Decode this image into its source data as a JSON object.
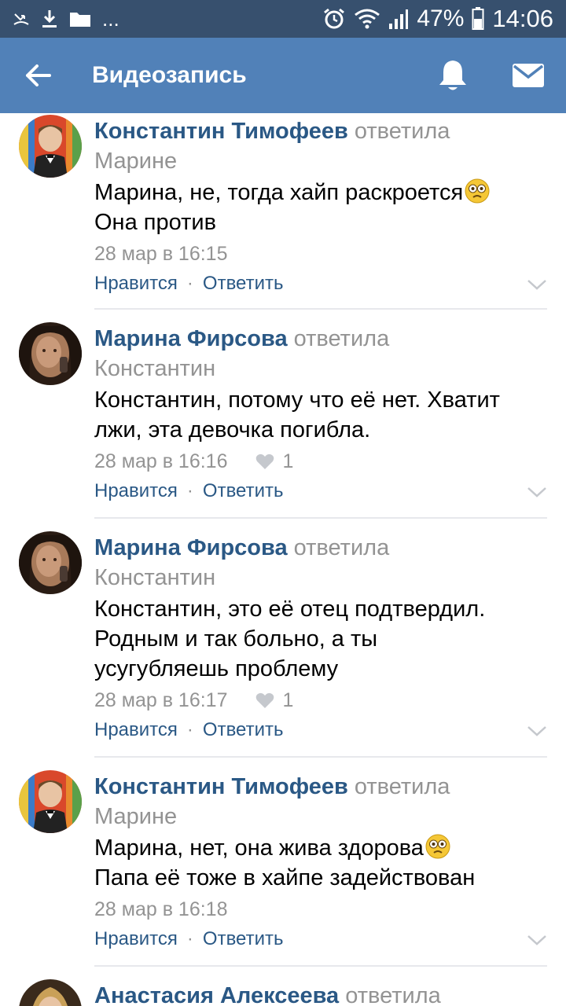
{
  "status_bar": {
    "more": "...",
    "battery": "47%",
    "time": "14:06"
  },
  "app_bar": {
    "title": "Видеозапись"
  },
  "comments": [
    {
      "author": "Константин Тимофеев",
      "verb": "ответила",
      "addressee": "Марине",
      "text_line1": "Марина, не, тогда хайп раскроется",
      "text_line2": "Она против",
      "date": "28 мар в 16:15",
      "likes": "",
      "like_label": "Нравится",
      "reply_label": "Ответить"
    },
    {
      "author": "Марина Фирсова",
      "verb": "ответила",
      "addressee": "Константин",
      "text_line1": "Константин, потому что её нет. Хватит",
      "text_line2": "лжи, эта девочка погибла.",
      "date": "28 мар в 16:16",
      "likes": "1",
      "like_label": "Нравится",
      "reply_label": "Ответить"
    },
    {
      "author": "Марина Фирсова",
      "verb": "ответила",
      "addressee": "Константин",
      "text_line1": "Константин, это её отец подтвердил.",
      "text_line2": "Родным и так больно, а ты",
      "text_line3": "усугубляешь проблему",
      "date": "28 мар в 16:17",
      "likes": "1",
      "like_label": "Нравится",
      "reply_label": "Ответить"
    },
    {
      "author": "Константин Тимофеев",
      "verb": "ответила",
      "addressee": "Марине",
      "text_line1": "Марина, нет, она жива здорова",
      "text_line2": "Папа её тоже в хайпе задействован",
      "date": "28 мар в 16:18",
      "likes": "",
      "like_label": "Нравится",
      "reply_label": "Ответить"
    },
    {
      "author": "Анастасия Алексеева",
      "verb": "ответила"
    }
  ],
  "colors": {
    "status_bar": "#37506e",
    "app_bar": "#5181b8",
    "link": "#2a5885",
    "secondary": "#939393"
  },
  "icons": [
    "back-arrow-icon",
    "bell-icon",
    "mail-icon",
    "heart-icon",
    "chevron-down-icon",
    "flushed-emoji-icon"
  ]
}
